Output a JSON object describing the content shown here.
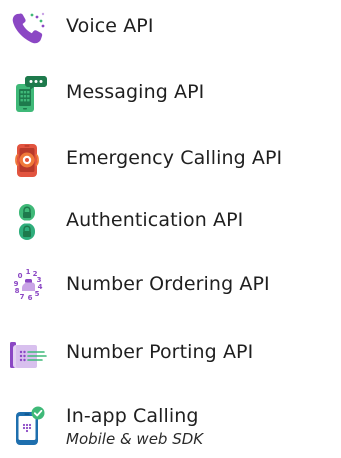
{
  "colors": {
    "purple": "#8b47c4",
    "light_purple": "#c9a4e6",
    "green": "#3fb978",
    "dark_green": "#1e7a4c",
    "teal_green": "#2fae7c",
    "red": "#e2543f",
    "orange": "#f07a3a",
    "phone_blue": "#1e6fae",
    "text": "#1f1f1f"
  },
  "products": [
    {
      "label": "Voice API",
      "icon": "phone-icon"
    },
    {
      "label": "Messaging API",
      "icon": "sms-phone-icon"
    },
    {
      "label": "Emergency Calling API",
      "icon": "emergency-phone-icon"
    },
    {
      "label": "Authentication API",
      "icon": "lock-icon"
    },
    {
      "label": "Number Ordering API",
      "icon": "dial-pad-icon"
    },
    {
      "label": "Number Porting API",
      "icon": "porting-icon"
    },
    {
      "label": "In-app Calling",
      "sublabel": "Mobile & web SDK",
      "icon": "mobile-app-icon"
    }
  ]
}
